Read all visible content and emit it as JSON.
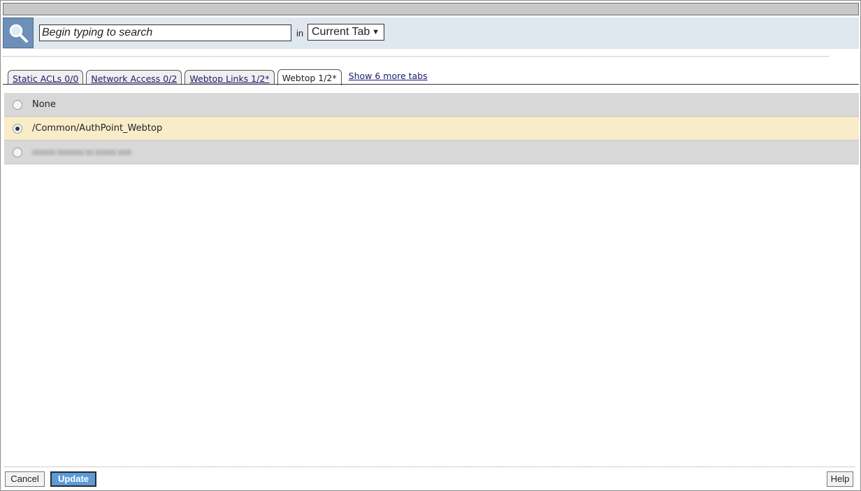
{
  "search": {
    "placeholder": "Begin typing to search",
    "in_label": "in",
    "scope_value": "Current Tab",
    "scope_arrow": "▼"
  },
  "tabs": [
    {
      "label": "Static ACLs 0/0",
      "active": false
    },
    {
      "label": "Network Access 0/2",
      "active": false
    },
    {
      "label": "Webtop Links 1/2*",
      "active": false
    },
    {
      "label": "Webtop 1/2*",
      "active": true
    }
  ],
  "more_tabs_label": "Show 6 more tabs",
  "options": [
    {
      "label": "None",
      "checked": false
    },
    {
      "label": "/Common/AuthPoint_Webtop",
      "checked": true
    },
    {
      "label": "",
      "checked": false,
      "redacted": true
    }
  ],
  "buttons": {
    "cancel": "Cancel",
    "update": "Update",
    "help": "Help"
  },
  "colors": {
    "selected_row": "#f8ecc9",
    "row": "#d8d8d8",
    "update_button": "#5b9bd8",
    "search_bar": "#dfe7ef",
    "search_icon_bg": "#6d8fb8"
  },
  "icons": {
    "search": "magnifier-icon"
  }
}
